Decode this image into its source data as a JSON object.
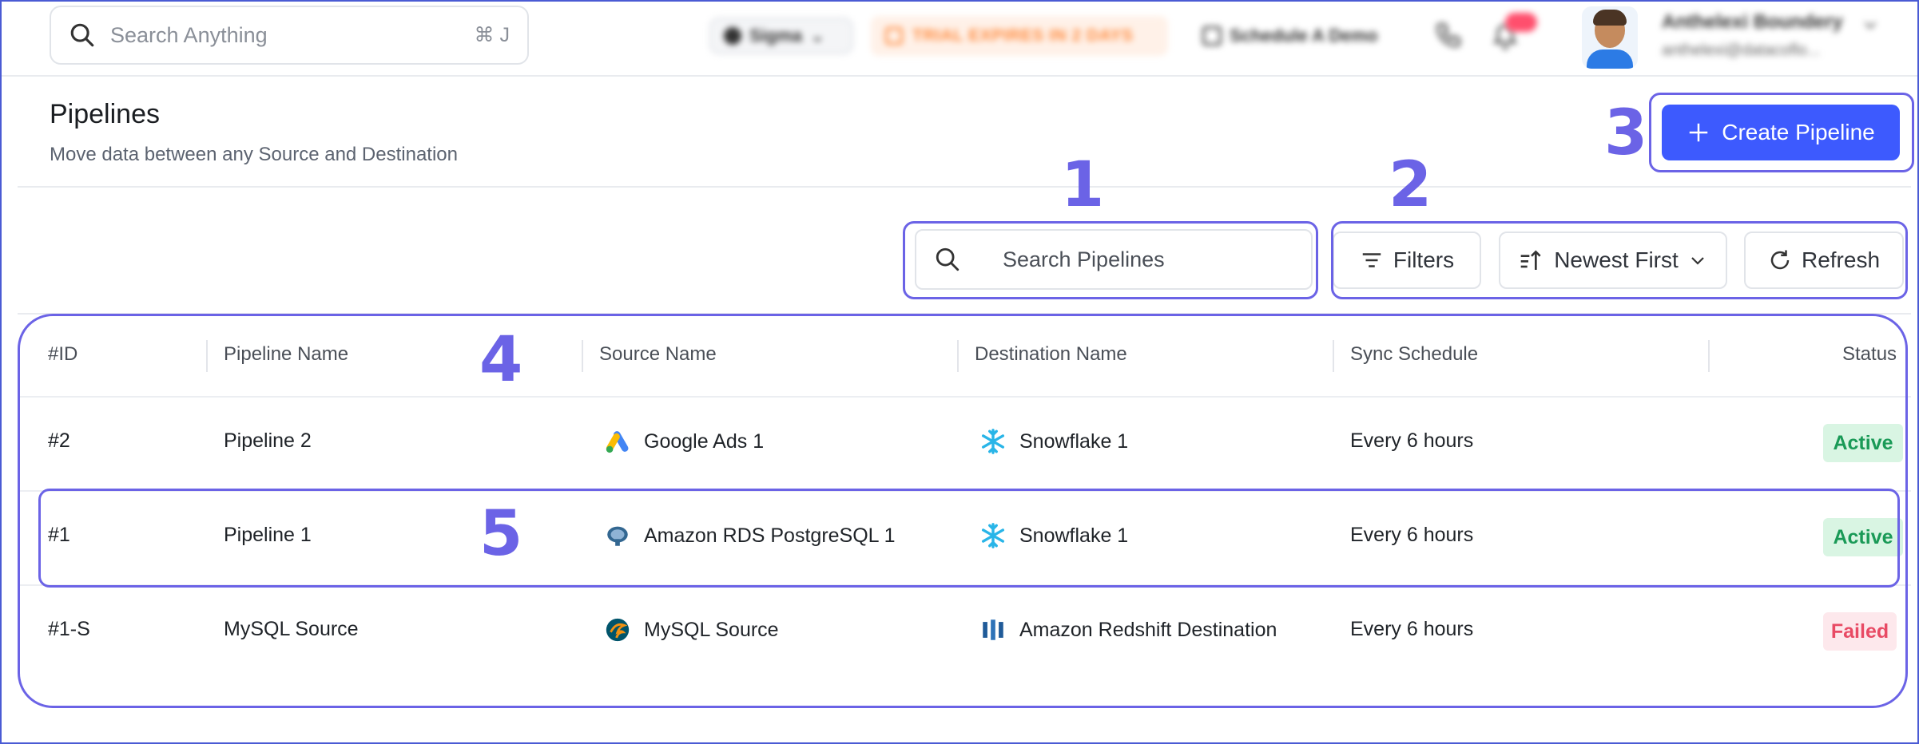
{
  "topbar": {
    "search_placeholder": "Search Anything",
    "search_shortcut": "⌘ J",
    "workspace": "Sigma",
    "trial_notice": "TRIAL EXPIRES IN 2 DAYS",
    "demo_label": "Schedule A Demo",
    "user_name": "Anthelexi Boundery",
    "user_email": "anthelexi@datacoflo..."
  },
  "page": {
    "title": "Pipelines",
    "subtitle": "Move data between any Source and Destination",
    "create_label": "Create Pipeline"
  },
  "toolbar": {
    "search_placeholder": "Search Pipelines",
    "filters_label": "Filters",
    "sort_label": "Newest First",
    "refresh_label": "Refresh"
  },
  "table": {
    "headers": {
      "id": "#ID",
      "name": "Pipeline Name",
      "source": "Source Name",
      "destination": "Destination Name",
      "schedule": "Sync Schedule",
      "status": "Status"
    },
    "rows": [
      {
        "id": "#2",
        "name": "Pipeline 2",
        "source": "Google Ads 1",
        "source_icon": "google-ads-icon",
        "destination": "Snowflake 1",
        "destination_icon": "snowflake-icon",
        "schedule": "Every 6 hours",
        "status": "Active"
      },
      {
        "id": "#1",
        "name": "Pipeline 1",
        "source": "Amazon RDS PostgreSQL 1",
        "source_icon": "postgresql-icon",
        "destination": "Snowflake 1",
        "destination_icon": "snowflake-icon",
        "schedule": "Every 6 hours",
        "status": "Active"
      },
      {
        "id": "#1-S",
        "name": "MySQL Source",
        "source": "MySQL Source",
        "source_icon": "mysql-icon",
        "destination": "Amazon Redshift Destination",
        "destination_icon": "redshift-icon",
        "schedule": "Every 6 hours",
        "status": "Failed"
      }
    ]
  },
  "annotations": {
    "n1": "1",
    "n2": "2",
    "n3": "3",
    "n4": "4",
    "n5": "5"
  },
  "colors": {
    "primary": "#3d5afe",
    "annotation": "#6b63e6",
    "active_bg": "#d9f5e3",
    "active_fg": "#1a9a57",
    "failed_bg": "#fde8ec",
    "failed_fg": "#e84a64"
  }
}
